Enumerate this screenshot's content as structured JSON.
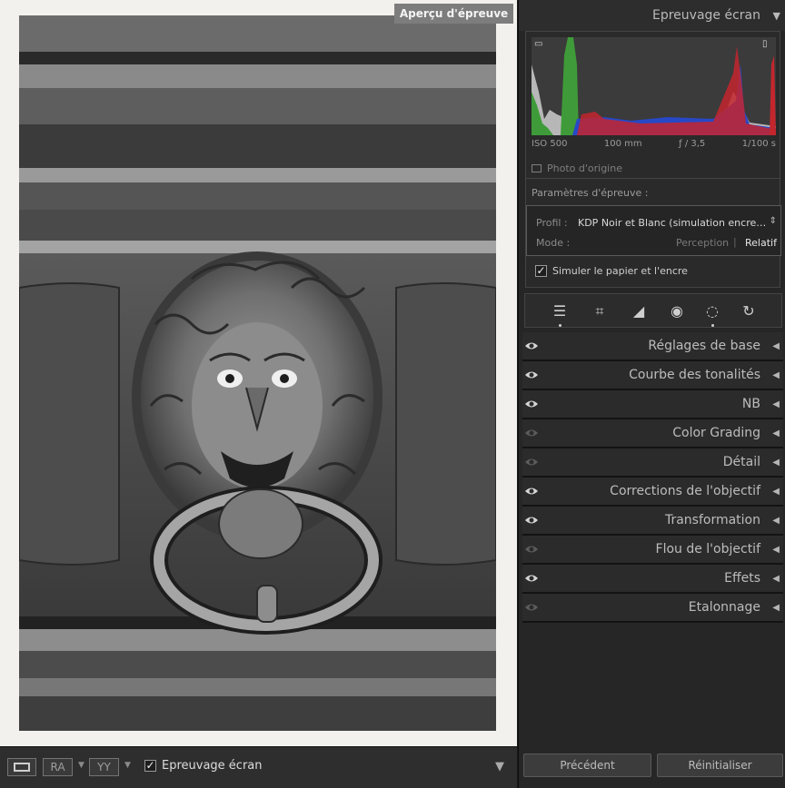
{
  "photo_area": {
    "badge": "Aperçu d'épreuve"
  },
  "toolbar": {
    "view_mode_icon": "loupe-view-icon",
    "btn_ra": "RA",
    "btn_yy": "YY",
    "proof_label": "Epreuvage écran",
    "proof_checked": true
  },
  "right_panel": {
    "header_title": "Epreuvage écran",
    "histogram": {
      "iso": "ISO 500",
      "focal": "100 mm",
      "aperture": "ƒ / 3,5",
      "shutter": "1/100 s",
      "colors": {
        "red": "#c4262e",
        "green": "#3f9b39",
        "blue": "#2748c7",
        "gray": "#b7b7b7"
      }
    },
    "original_photo_label": "Photo d'origine",
    "proof_params": {
      "label": "Paramètres d'épreuve :",
      "profile_label": "Profil :",
      "profile_value": "KDP Noir et Blanc (simulation encre noir...",
      "mode_label": "Mode :",
      "mode_perception": "Perception",
      "mode_relative": "Relatif",
      "simulate_label": "Simuler le papier et l'encre",
      "simulate_checked": true
    },
    "tools": [
      {
        "icon": "sliders-icon",
        "active": true
      },
      {
        "icon": "crop-icon",
        "active": false
      },
      {
        "icon": "eraser-icon",
        "active": false
      },
      {
        "icon": "red-eye-icon",
        "active": false
      },
      {
        "icon": "mask-icon",
        "active": true
      },
      {
        "icon": "presets-icon",
        "active": false
      }
    ],
    "panels": [
      {
        "name": "Réglages de base",
        "visible": true
      },
      {
        "name": "Courbe des tonalités",
        "visible": true
      },
      {
        "name": "NB",
        "visible": true
      },
      {
        "name": "Color Grading",
        "visible": false
      },
      {
        "name": "Détail",
        "visible": false
      },
      {
        "name": "Corrections de l'objectif",
        "visible": true
      },
      {
        "name": "Transformation",
        "visible": true
      },
      {
        "name": "Flou de l'objectif",
        "visible": false
      },
      {
        "name": "Effets",
        "visible": true
      },
      {
        "name": "Etalonnage",
        "visible": false
      }
    ],
    "buttons": {
      "previous": "Précédent",
      "reset": "Réinitialiser"
    }
  }
}
